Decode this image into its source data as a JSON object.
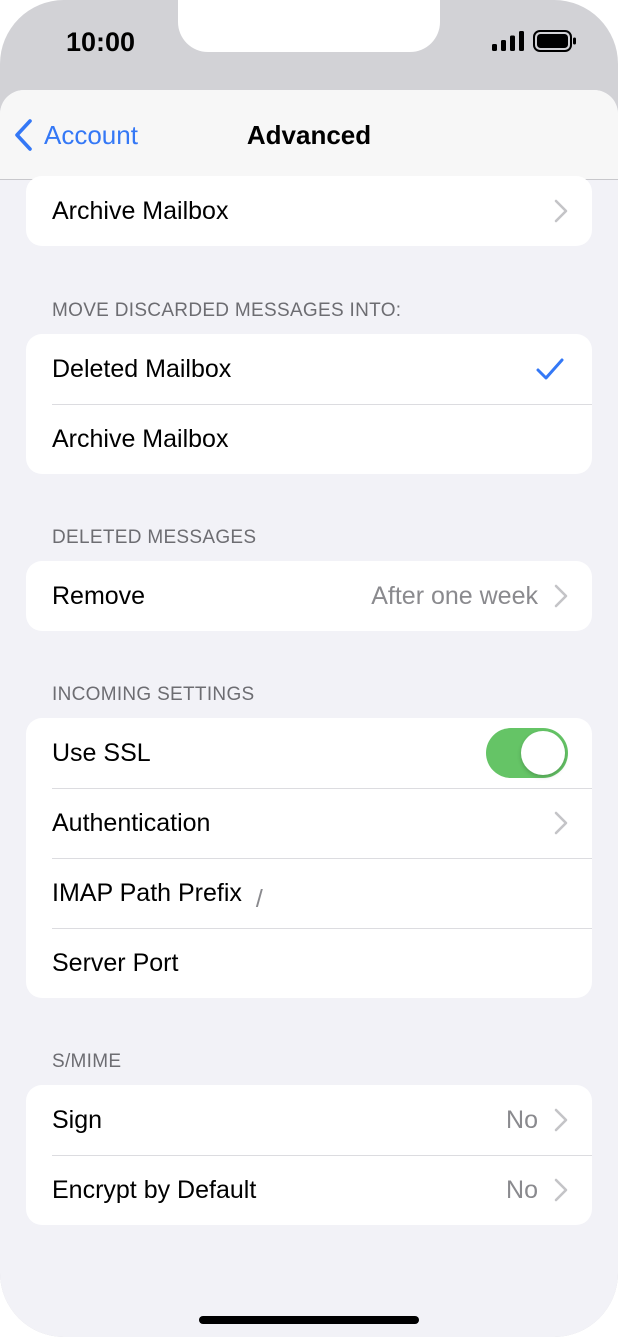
{
  "status_bar": {
    "time": "10:00"
  },
  "navbar": {
    "back_label": "Account",
    "title": "Advanced"
  },
  "top_group": {
    "archive_mailbox": "Archive Mailbox"
  },
  "discarded": {
    "header": "MOVE DISCARDED MESSAGES INTO:",
    "deleted_mailbox": "Deleted Mailbox",
    "archive_mailbox": "Archive Mailbox",
    "selected": "Deleted Mailbox"
  },
  "deleted_messages": {
    "header": "DELETED MESSAGES",
    "remove_label": "Remove",
    "remove_value": "After one week"
  },
  "incoming": {
    "header": "INCOMING SETTINGS",
    "use_ssl_label": "Use SSL",
    "use_ssl_on": true,
    "authentication_label": "Authentication",
    "imap_prefix_label": "IMAP Path Prefix",
    "imap_prefix_value": "/",
    "server_port_label": "Server Port"
  },
  "smime": {
    "header": "S/MIME",
    "sign_label": "Sign",
    "sign_value": "No",
    "encrypt_label": "Encrypt by Default",
    "encrypt_value": "No"
  },
  "colors": {
    "accent": "#3478f6",
    "toggle_on": "#65c466",
    "background": "#f2f2f7",
    "secondary_text": "#8a8a8e"
  }
}
